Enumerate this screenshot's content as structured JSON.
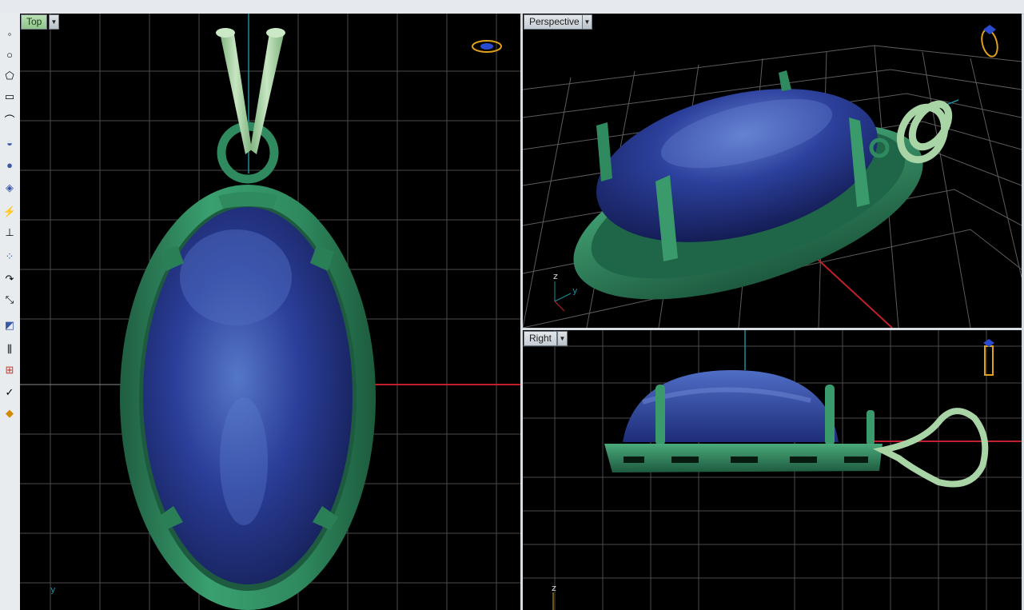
{
  "viewports": {
    "top": {
      "title": "Top",
      "axis_y": "y"
    },
    "perspective": {
      "title": "Perspective",
      "axis_z": "z",
      "axis_y": "y"
    },
    "right": {
      "title": "Right",
      "axis_z": "z"
    }
  },
  "toolbar": {
    "tools": [
      "point-icon",
      "circle-icon",
      "polygon-icon",
      "rectangle-icon",
      "arc-icon",
      "sphere-icon",
      "surface-icon",
      "boolean-icon",
      "move-icon",
      "lightning-icon",
      "project-icon",
      "array-icon",
      "fillet-icon",
      "scale-icon",
      "mirror-icon",
      "grid-icon",
      "dimension-icon",
      "check-icon",
      "paint-bucket-icon"
    ]
  },
  "colors": {
    "gem_blue": "#2a3f9a",
    "setting_green": "#2f8a5f",
    "bail_light_green": "#a9d4a6",
    "grid_line": "#5a5a5a",
    "x_axis": "#c0202a",
    "y_axis": "#1e8c9c"
  }
}
